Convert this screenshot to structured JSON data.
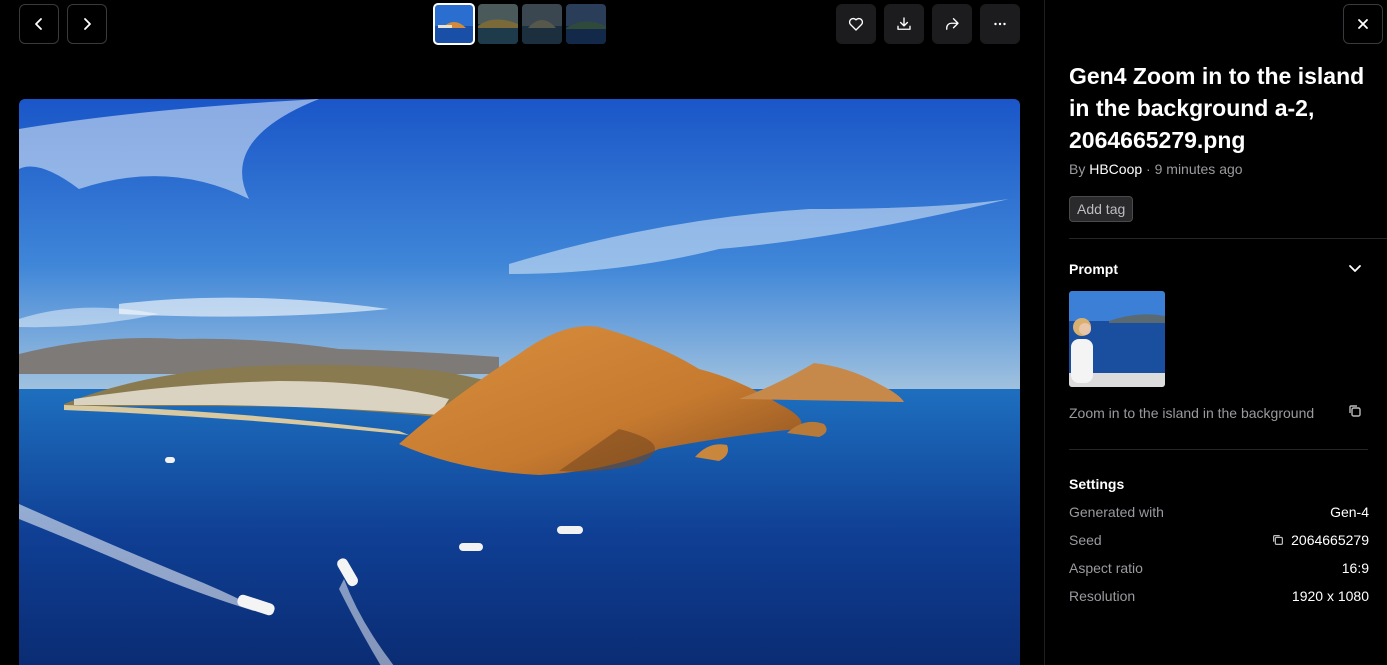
{
  "toolbar": {
    "prev_icon": "chevron-left-icon",
    "next_icon": "chevron-right-icon",
    "actions": [
      "heart-icon",
      "download-icon",
      "share-icon",
      "more-horizontal-icon"
    ]
  },
  "thumbnails": [
    {
      "name": "thumbnail-1",
      "active": true
    },
    {
      "name": "thumbnail-2",
      "active": false
    },
    {
      "name": "thumbnail-3",
      "active": false
    },
    {
      "name": "thumbnail-4",
      "active": false
    }
  ],
  "panel": {
    "title": "Gen4 Zoom in to the island in the background a-2, 2064665279.png",
    "by_prefix": "By ",
    "author": "HBCoop",
    "separator": " · ",
    "time": "9 minutes ago",
    "add_tag": "Add tag",
    "prompt": {
      "heading": "Prompt",
      "text": "Zoom in to the island in the background"
    },
    "settings": {
      "heading": "Settings",
      "rows": [
        {
          "label": "Generated with",
          "value": "Gen-4"
        },
        {
          "label": "Seed",
          "value": "2064665279"
        },
        {
          "label": "Aspect ratio",
          "value": "16:9"
        },
        {
          "label": "Resolution",
          "value": "1920 x 1080"
        }
      ]
    }
  },
  "colors": {
    "background": "#000000",
    "button": "#1c1c1e",
    "muted_text": "#9a9a9f",
    "tag_bg": "#2a2a2c"
  }
}
